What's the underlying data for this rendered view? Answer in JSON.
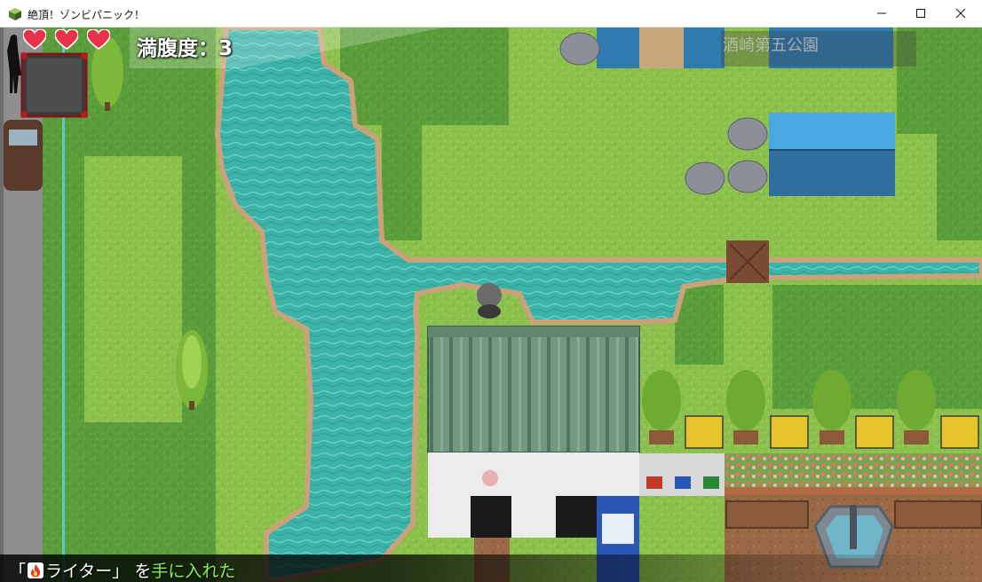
{
  "window": {
    "title": "絶頂！ゾンビパニック！",
    "buttons": {
      "minimize": "minimize-icon",
      "maximize": "maximize-icon",
      "close": "close-icon"
    }
  },
  "hud": {
    "hunger_label": "満腹度",
    "hunger_separator": "：",
    "hunger_value": "3",
    "hearts": [
      "heart-icon",
      "heart-icon",
      "heart-icon"
    ],
    "heart_color": "#e8314a"
  },
  "map": {
    "park_sign": "酒崎第五公園"
  },
  "message": {
    "open_bracket": "「",
    "item_icon": "fire-icon",
    "item_name": "ライター",
    "close_bracket": "」",
    "particle": "を",
    "highlight": "手に入れた",
    "highlight_color": "#88ee55"
  }
}
